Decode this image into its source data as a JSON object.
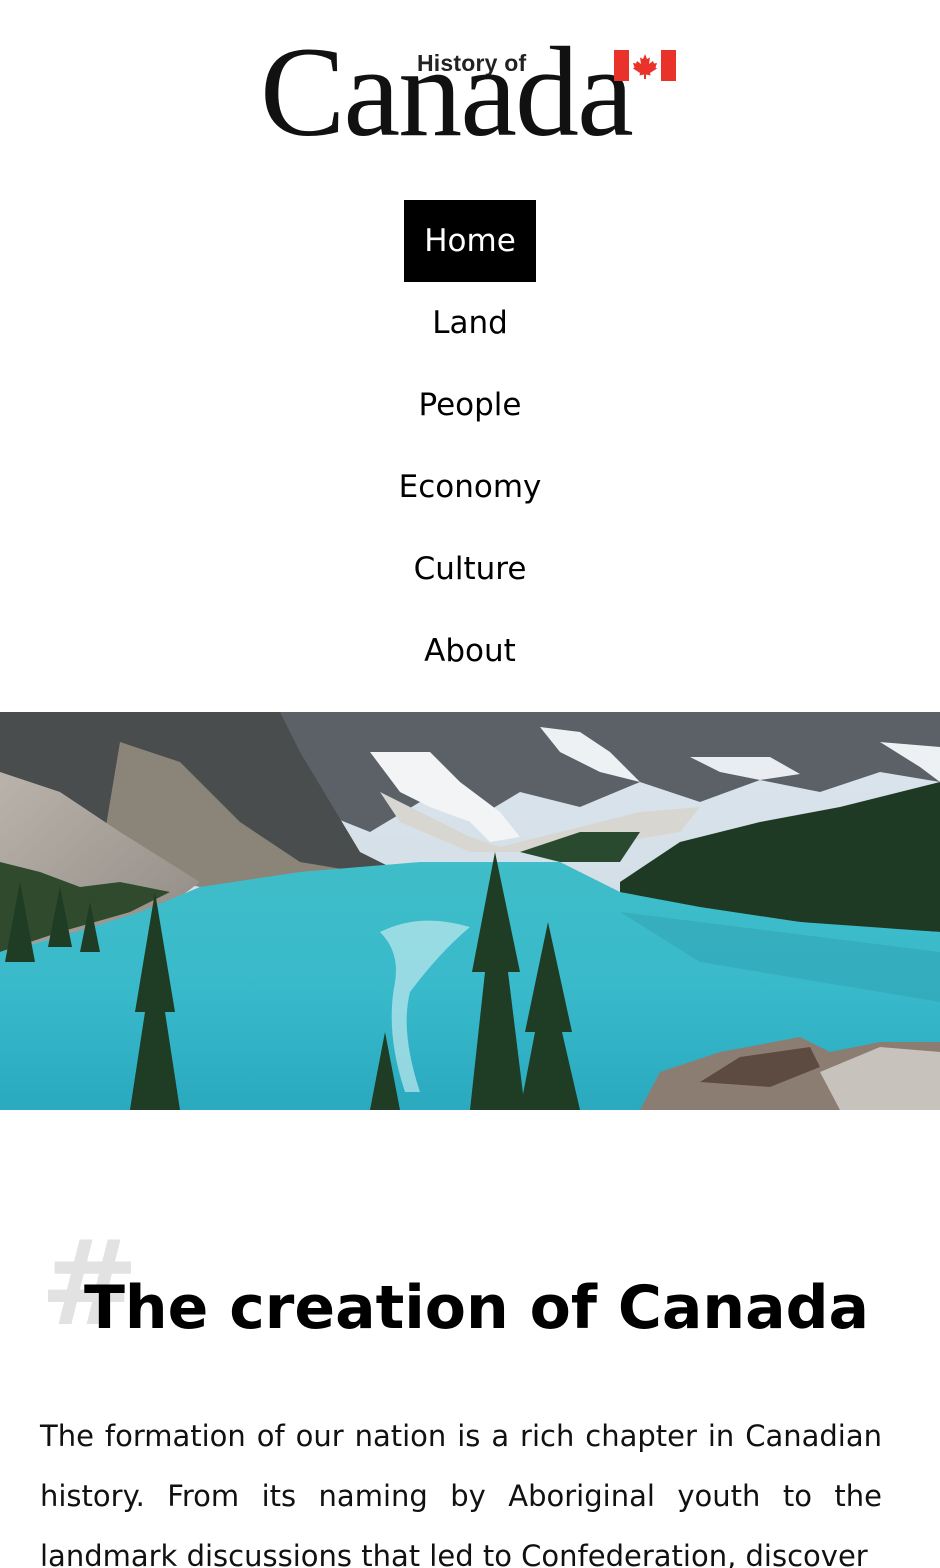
{
  "logo": {
    "small_text": "History of",
    "big_text": "Canada",
    "flag_icon": "canadian-flag-icon",
    "flag_color": "#e8322a"
  },
  "nav": {
    "items": [
      {
        "label": "Home",
        "active": true
      },
      {
        "label": "Land",
        "active": false
      },
      {
        "label": "People",
        "active": false
      },
      {
        "label": "Economy",
        "active": false
      },
      {
        "label": "Culture",
        "active": false
      },
      {
        "label": "About",
        "active": false
      }
    ]
  },
  "hero": {
    "image": "mountain-lake-photo"
  },
  "article": {
    "hash_symbol": "#",
    "title": "The creation of Canada",
    "intro": "The formation of our nation is a rich chapter in Canadian history. From its naming by Aboriginal youth to the landmark discussions that led to Confederation, discover"
  },
  "colors": {
    "nav_active_bg": "#000000",
    "nav_active_text": "#ffffff",
    "hash_color": "#e2e2e2",
    "lake": "#3bbfcc"
  }
}
